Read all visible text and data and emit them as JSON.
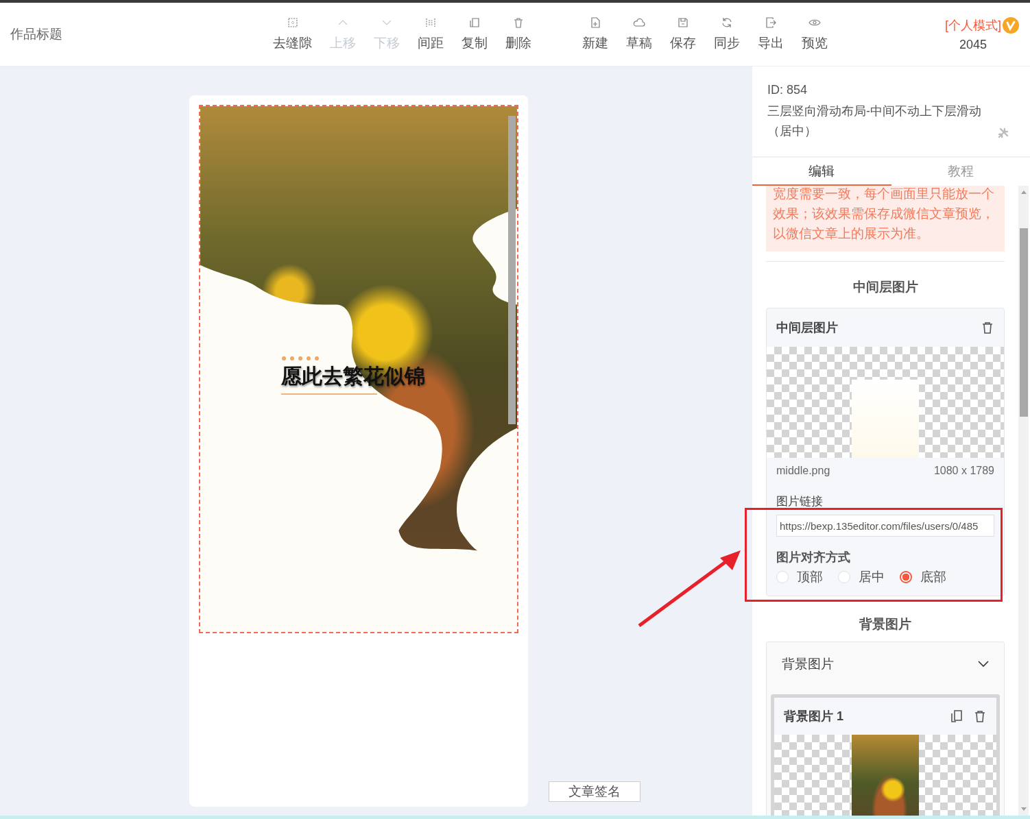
{
  "header": {
    "title_placeholder": "作品标题",
    "toolbar_left": [
      {
        "label": "去缝隙",
        "disabled": false
      },
      {
        "label": "上移",
        "disabled": true
      },
      {
        "label": "下移",
        "disabled": true
      },
      {
        "label": "间距",
        "disabled": false
      },
      {
        "label": "复制",
        "disabled": false
      },
      {
        "label": "删除",
        "disabled": false
      }
    ],
    "toolbar_right": [
      {
        "label": "新建",
        "disabled": false
      },
      {
        "label": "草稿",
        "disabled": false
      },
      {
        "label": "保存",
        "disabled": false
      },
      {
        "label": "同步",
        "disabled": false
      },
      {
        "label": "导出",
        "disabled": false
      },
      {
        "label": "预览",
        "disabled": false
      }
    ],
    "mode": "[个人模式]",
    "count": "2045"
  },
  "canvas": {
    "heading": "愿此去繁花似锦",
    "signature_button": "文章签名"
  },
  "panel": {
    "id": "ID: 854",
    "template_name": "三层竖向滑动布局-中间不动上下层滑动（居中）",
    "tabs": [
      {
        "label": "编辑",
        "selected": true
      },
      {
        "label": "教程",
        "selected": false
      }
    ],
    "notice": "宽度需要一致，每个画面里只能放一个效果；该效果需保存成微信文章预览，以微信文章上的展示为准。",
    "middle_section": {
      "heading": "中间层图片",
      "card_title": "中间层图片",
      "filename": "middle.png",
      "dimensions": "1080 x 1789",
      "link_label": "图片链接",
      "link_value": "https://bexp.135editor.com/files/users/0/485",
      "align_label": "图片对齐方式",
      "align_options": [
        {
          "label": "顶部",
          "selected": false
        },
        {
          "label": "居中",
          "selected": false
        },
        {
          "label": "底部",
          "selected": true
        }
      ]
    },
    "background_section": {
      "heading": "背景图片",
      "group_title": "背景图片",
      "group_expanded": true,
      "item_title": "背景图片 1"
    }
  }
}
